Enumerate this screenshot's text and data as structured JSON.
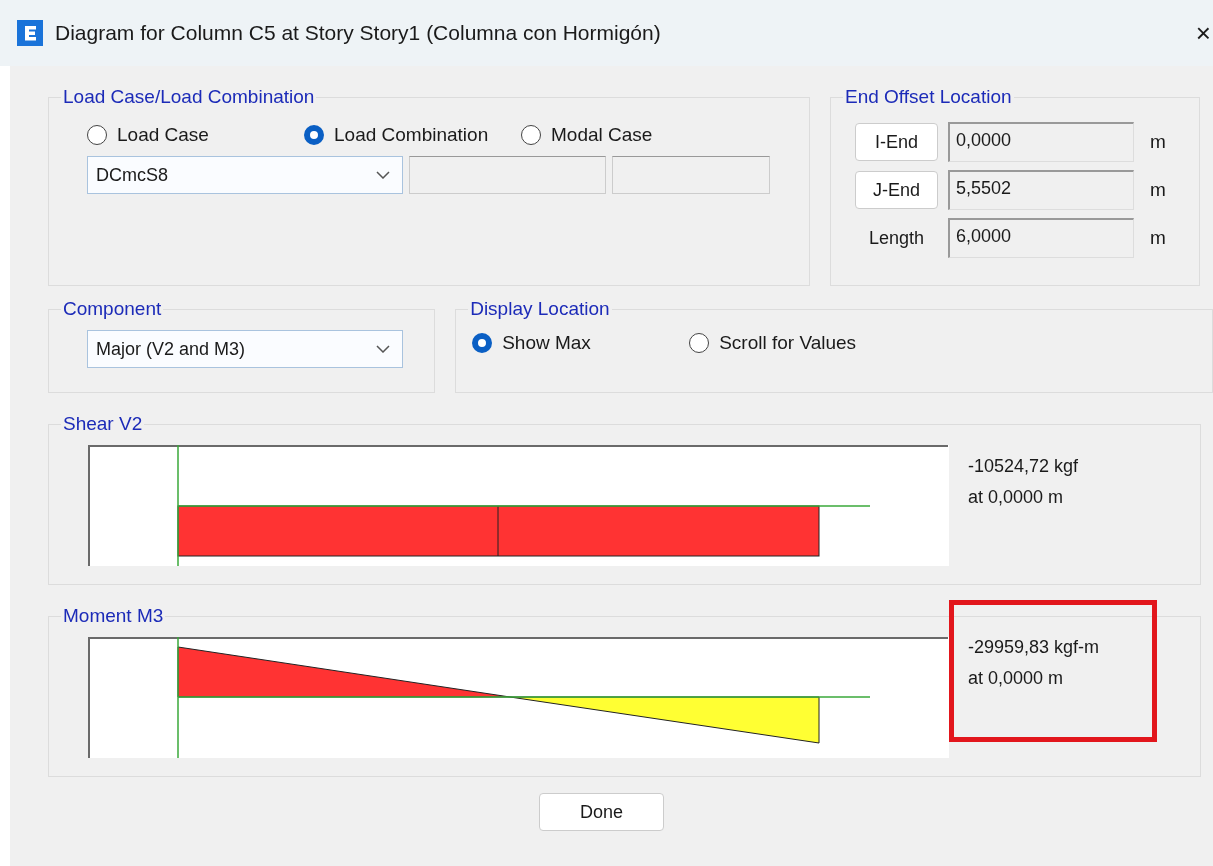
{
  "window": {
    "title": "Diagram for Column C5 at Story Story1 (Columna con Hormigón)",
    "close": "×"
  },
  "load_case_group": {
    "title": "Load Case/Load Combination",
    "options": [
      {
        "label": "Load Case",
        "selected": false
      },
      {
        "label": "Load Combination",
        "selected": true
      },
      {
        "label": "Modal Case",
        "selected": false
      }
    ],
    "combo": {
      "value": "DCmcS8"
    }
  },
  "end_offset": {
    "title": "End Offset Location",
    "rows": [
      {
        "kind": "button",
        "label": "I-End",
        "value": "0,0000",
        "unit": "m"
      },
      {
        "kind": "button",
        "label": "J-End",
        "value": "5,5502",
        "unit": "m"
      },
      {
        "kind": "label",
        "label": "Length",
        "value": "6,0000",
        "unit": "m"
      }
    ]
  },
  "component": {
    "title": "Component",
    "combo": {
      "value": "Major (V2 and M3)"
    }
  },
  "display_location": {
    "title": "Display Location",
    "options": [
      {
        "label": "Show Max",
        "selected": true
      },
      {
        "label": "Scroll for Values",
        "selected": false
      }
    ]
  },
  "diagrams": [
    {
      "kind": "shear",
      "title": "Shear V2",
      "max": "-10524,72 kgf",
      "location": "at 0,0000 m",
      "highlighted": false
    },
    {
      "kind": "moment",
      "title": "Moment M3",
      "max": "-29959,83 kgf-m",
      "location": "at 0,0000 m",
      "highlighted": true
    }
  ],
  "buttons": [
    "Done"
  ]
}
